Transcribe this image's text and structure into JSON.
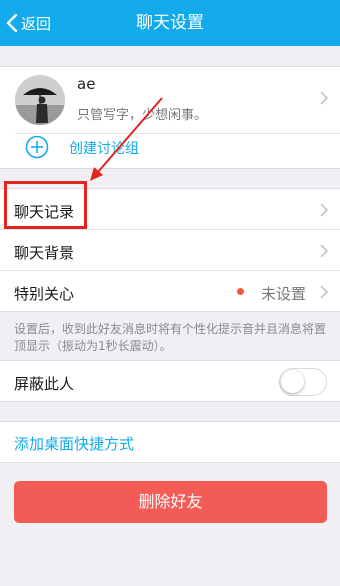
{
  "colors": {
    "accent": "#12aaeb",
    "danger": "#f35b56",
    "annotation_red": "#e3251f",
    "background": "#efeff4"
  },
  "header": {
    "back_label": "返回",
    "title": "聊天设置"
  },
  "profile": {
    "nickname": "ae",
    "signature": "只管写字，少想闲事。",
    "create_group_label": "创建讨论组"
  },
  "settings": {
    "chat_history": "聊天记录",
    "chat_background": "聊天背景",
    "special_care": "特别关心",
    "special_care_value": "未设置"
  },
  "hint": "设置后，收到此好友消息时将有个性化提示音并且消息将置顶显示（振动为1秒长震动）。",
  "block": {
    "label": "屏蔽此人",
    "toggle_on": false
  },
  "shortcut_label": "添加桌面快捷方式",
  "delete_label": "删除好友",
  "icons": [
    "back-chevron-icon",
    "avatar-image",
    "chevron-right-icon",
    "plus-circle-icon",
    "annotation-arrow-icon"
  ]
}
